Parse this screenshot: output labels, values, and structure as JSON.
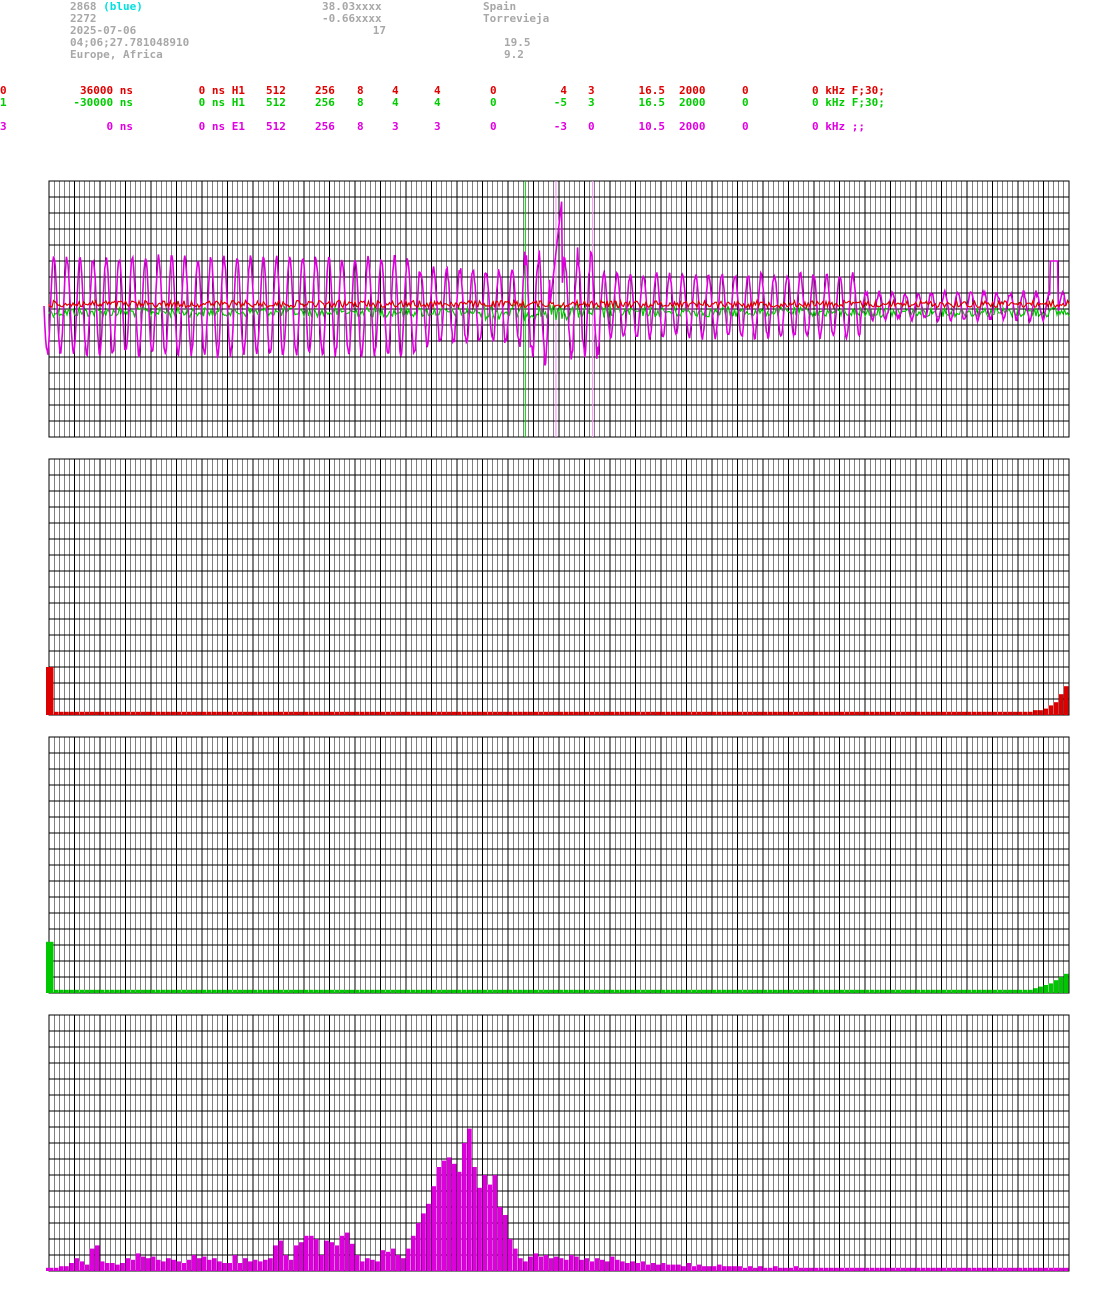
{
  "header": {
    "id_num": "2868",
    "id_tag": "(blue)",
    "line2_left": "2272",
    "date": "2025-07-06",
    "time": "04;06;27.781048910",
    "region": "Europe, Africa",
    "lat": "38.03xxxx",
    "lon": "-0.66xxxx",
    "mid3": "17",
    "country": "Spain",
    "city": "Torrevieja",
    "val1": "19.5",
    "val2": "9.2"
  },
  "channels": [
    {
      "color": "#e00000",
      "cols": [
        "0",
        "36000 ns",
        "0 ns H1",
        "512",
        "256",
        "8",
        "4",
        "4",
        "0",
        "4",
        "3",
        "16.5",
        "2000",
        "0",
        "0 kHz F;30;"
      ]
    },
    {
      "color": "#00cc00",
      "cols": [
        "1",
        "-30000 ns",
        "0 ns H1",
        "512",
        "256",
        "8",
        "4",
        "4",
        "0",
        "-5",
        "3",
        "16.5",
        "2000",
        "0",
        "0 kHz F;30;"
      ]
    },
    {
      "color": "#e000e0",
      "cols": [
        "3",
        "0 ns",
        "0 ns E1",
        "512",
        "256",
        "8",
        "3",
        "3",
        "0",
        "-3",
        "0",
        "10.5",
        "2000",
        "0",
        "0 kHz ;;"
      ]
    }
  ],
  "colors": {
    "red": "#dd0000",
    "green": "#00c800",
    "magenta": "#dd00dd",
    "grid": "#000000",
    "header_gray": "#a8a8a8",
    "cyan": "#00e0e0"
  },
  "chart_data": [
    {
      "type": "line",
      "panel": "waveform",
      "series": [
        {
          "color": "#dd00dd",
          "shape": "oscillation",
          "amplitude_rows": [
            3.5,
            3.5,
            2.0
          ]
        },
        {
          "color": "#dd0000",
          "shape": "noise-near-center"
        },
        {
          "color": "#00c800",
          "shape": "noise-slightly-below-center"
        }
      ],
      "markers": [
        {
          "color": "#00c800",
          "position_col_fraction": 0.467
        },
        {
          "color": "#ff88ff",
          "position_col_fraction": 0.497
        },
        {
          "color": "#ff88ff",
          "position_col_fraction": 0.533
        }
      ],
      "grid": true
    },
    {
      "type": "bar",
      "panel": "histogram-red",
      "color": "#dd0000",
      "bins": 200,
      "values_rows": {
        "first": 3.0,
        "low": 0.2,
        "tail": [
          0.3,
          0.3,
          0.4,
          0.6,
          0.8,
          1.3,
          1.8
        ]
      },
      "grid": true
    },
    {
      "type": "bar",
      "panel": "histogram-green",
      "color": "#00c800",
      "bins": 200,
      "values_rows": {
        "first": 3.2,
        "low": 0.2,
        "tail": [
          0.3,
          0.4,
          0.5,
          0.6,
          0.8,
          1.0,
          1.2
        ]
      },
      "grid": true
    },
    {
      "type": "bar",
      "panel": "histogram-magenta",
      "color": "#dd00dd",
      "bins": 200,
      "values_rows": [
        0.2,
        0.2,
        0.3,
        0.3,
        0.5,
        0.8,
        0.6,
        0.4,
        1.4,
        1.6,
        0.6,
        0.5,
        0.5,
        0.4,
        0.5,
        0.8,
        0.7,
        1.1,
        0.9,
        0.8,
        0.9,
        0.7,
        0.6,
        0.8,
        0.7,
        0.6,
        0.5,
        0.7,
        1.0,
        0.8,
        0.9,
        0.7,
        0.8,
        0.6,
        0.5,
        0.5,
        1.0,
        0.5,
        0.8,
        0.6,
        0.7,
        0.6,
        0.7,
        0.8,
        1.6,
        1.9,
        1.0,
        0.7,
        1.6,
        1.8,
        2.2,
        2.2,
        2.0,
        1.0,
        1.9,
        1.8,
        1.6,
        2.2,
        2.4,
        1.7,
        1.0,
        0.6,
        0.8,
        0.7,
        0.6,
        1.3,
        1.2,
        1.4,
        1.0,
        0.8,
        1.4,
        2.2,
        3.0,
        3.6,
        4.2,
        5.3,
        6.5,
        6.9,
        7.1,
        6.7,
        6.2,
        8.0,
        8.9,
        6.5,
        5.2,
        6.0,
        5.4,
        6.0,
        4.0,
        3.5,
        2.0,
        1.4,
        0.8,
        0.6,
        0.9,
        1.1,
        0.9,
        1.0,
        0.8,
        0.9,
        0.8,
        0.7,
        1.0,
        0.9,
        0.7,
        0.8,
        0.6,
        0.8,
        0.7,
        0.6,
        0.9,
        0.7,
        0.6,
        0.5,
        0.6,
        0.5,
        0.6,
        0.4,
        0.5,
        0.4,
        0.5,
        0.4,
        0.4,
        0.4,
        0.3,
        0.5,
        0.3,
        0.4,
        0.3,
        0.3,
        0.3,
        0.4,
        0.3,
        0.3,
        0.3,
        0.3,
        0.2,
        0.3,
        0.2,
        0.3,
        0.2,
        0.2,
        0.3,
        0.2,
        0.2,
        0.2,
        0.3,
        0.2,
        0.2,
        0.2,
        0.2,
        0.2,
        0.2,
        0.2,
        0.2,
        0.2,
        0.2,
        0.2,
        0.2,
        0.2,
        0.2,
        0.2,
        0.2,
        0.2,
        0.2,
        0.2,
        0.2,
        0.2,
        0.2,
        0.2,
        0.2,
        0.2,
        0.2,
        0.2,
        0.2,
        0.2,
        0.2,
        0.2,
        0.2,
        0.2,
        0.2,
        0.2,
        0.2,
        0.2,
        0.2,
        0.2,
        0.2,
        0.2,
        0.2,
        0.2,
        0.2,
        0.2,
        0.2,
        0.2,
        0.2,
        0.2,
        0.2,
        0.2,
        0.2,
        0.2
      ],
      "grid": true
    }
  ]
}
